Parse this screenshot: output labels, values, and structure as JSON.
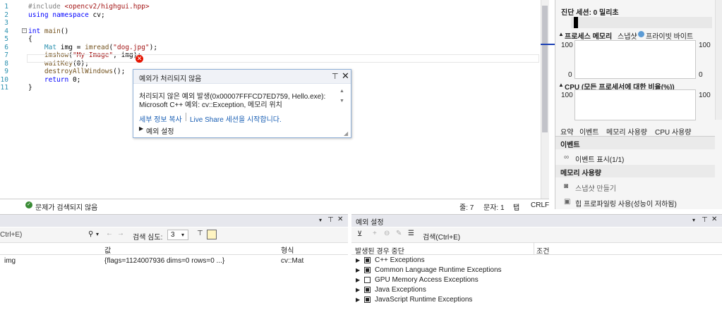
{
  "editor": {
    "lines": [
      {
        "n": "1",
        "code": "#include <opencv2/highgui.hpp>"
      },
      {
        "n": "2",
        "code": "using namespace cv;"
      },
      {
        "n": "3",
        "code": ""
      },
      {
        "n": "4",
        "code": "int main()"
      },
      {
        "n": "5",
        "code": "{"
      },
      {
        "n": "6",
        "code": "    Mat img = imread(\"dog.jpg\");"
      },
      {
        "n": "7",
        "code": "    imshow(\"My Image\", img);"
      },
      {
        "n": "8",
        "code": "    waitKey(0);"
      },
      {
        "n": "9",
        "code": "    destroyAllWindows();"
      },
      {
        "n": "10",
        "code": "    return 0;"
      },
      {
        "n": "11",
        "code": "}"
      }
    ]
  },
  "exception": {
    "title": "예외가 처리되지 않음",
    "message_line1": "처리되지 않은 예외 발생(0x00007FFFCD7ED759, Hello.exe):",
    "message_line2": "Microsoft C++ 예외: cv::Exception, 메모리 위치",
    "link_details": "세부 정보 복사",
    "link_liveshare": "Live Share 세션을 시작합니다.",
    "settings_label": "예외 설정"
  },
  "status_bar": {
    "issues": "문제가 검색되지 않음",
    "line": "줄: 7",
    "col": "문자: 1",
    "tab": "탭",
    "eol": "CRLF"
  },
  "diagnostics": {
    "session": "진단 세션: 0 밀리초",
    "memory_title": "프로세스 메모리",
    "snapshot_label": "스냅샷",
    "private_bytes": "프라이빗 바이트",
    "mem_max_left": "100",
    "mem_max_right": "100",
    "mem_min_left": "0",
    "mem_min_right": "0",
    "cpu_title": "CPU (모든 프로세서에 대한 비율(%))",
    "cpu_max_left": "100",
    "cpu_max_right": "100",
    "tabs": [
      "요약",
      "이벤트",
      "메모리 사용량",
      "CPU 사용량"
    ],
    "events_header": "이벤트",
    "show_events": "이벤트 표시(1/1)",
    "memory_header": "메모리 사용량",
    "take_snapshot": "스냅샷 만들기",
    "heap_profiling": "힙 프로파일링 사용(성능이 저하됨)"
  },
  "locals": {
    "search_placeholder": "Ctrl+E)",
    "search_depth_label": "검색 심도:",
    "search_depth_value": "3",
    "col_value": "값",
    "col_type": "형식",
    "rows": [
      {
        "name": "img",
        "value": "{flags=1124007936 dims=0 rows=0 ...}",
        "type": "cv::Mat"
      }
    ]
  },
  "exception_settings": {
    "title": "예외 설정",
    "search_placeholder": "검색(Ctrl+E)",
    "col_break": "발생된 경우 중단",
    "col_condition": "조건",
    "items": [
      {
        "label": "C++ Exceptions",
        "checked": true
      },
      {
        "label": "Common Language Runtime Exceptions",
        "checked": true
      },
      {
        "label": "GPU Memory Access Exceptions",
        "checked": false
      },
      {
        "label": "Java Exceptions",
        "checked": true
      },
      {
        "label": "JavaScript Runtime Exceptions",
        "checked": true
      }
    ]
  },
  "colors": {
    "accent": "#007acc",
    "error": "#e51400",
    "link": "#1a5fb4",
    "ok": "#388a34"
  }
}
